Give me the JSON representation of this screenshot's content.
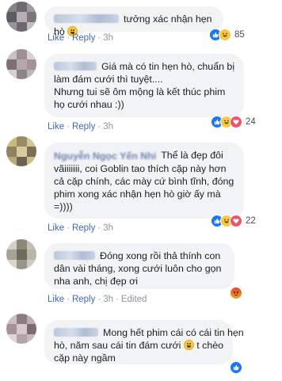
{
  "comments": [
    {
      "text_lines": [
        "tưởng xác nhận hẹn hò"
      ],
      "actions": {
        "like": "Like",
        "reply": "Reply",
        "time": "3h"
      },
      "reaction_count": "85",
      "reaction_icons": [
        "like-icon",
        "haha-icon"
      ]
    },
    {
      "text_lines": [
        "Giá mà có tin hẹn hò, chuẩn bị",
        "làm đám cưới thì tuyệt....",
        "Nhưng tui sẽ ôm mộng là kết thúc phim",
        "họ cưới nhau :))"
      ],
      "actions": {
        "like": "Like",
        "reply": "Reply",
        "time": "3h"
      },
      "reaction_count": "24",
      "reaction_icons": [
        "like-icon",
        "haha-icon",
        "love-icon"
      ]
    },
    {
      "name_blurred": "Nguyễn Ngọc Yến Nhi",
      "text_lines": [
        "Thể là đẹp đôi",
        "vãiiiiiii, coi Goblin tao thích cặp này hơn",
        "cả cặp chính, các mày cứ bình tĩnh, đóng",
        "phim xong xác nhận hẹn hò giờ ấy mà",
        "=))))"
      ],
      "actions": {
        "like": "Like",
        "reply": "Reply",
        "time": "3h"
      },
      "reaction_count": "22",
      "reaction_icons": [
        "like-icon",
        "haha-icon",
        "love-icon"
      ]
    },
    {
      "text_lines": [
        "Đóng xong rồi thả thính con",
        "dân vài tháng, xong cưới luôn cho gọn",
        "nha anh, chị đẹp ơi"
      ],
      "actions": {
        "like": "Like",
        "reply": "Reply",
        "time": "3h",
        "edited": "Edited"
      },
      "reaction_count": "",
      "reaction_icons": [
        "angry-icon"
      ]
    },
    {
      "text_lines": [
        "Mong hết phim cái có cái tin hẹn",
        "hò, năm sau cái tin đám cưới",
        "t chèo",
        "cặp này ngầm"
      ],
      "actions": {
        "like": "Like",
        "reply": "Reply",
        "time": "3h"
      },
      "reaction_count": "",
      "reaction_icons": [
        "like-icon"
      ]
    }
  ],
  "colors": {
    "bubble_bg": "#f2f3f5",
    "link": "#4267b2",
    "meta": "#90949c",
    "like_blue": "#1877f2",
    "haha_yellow": "#f7c844",
    "love_red": "#f25268",
    "angry_orange": "#e9710f"
  }
}
